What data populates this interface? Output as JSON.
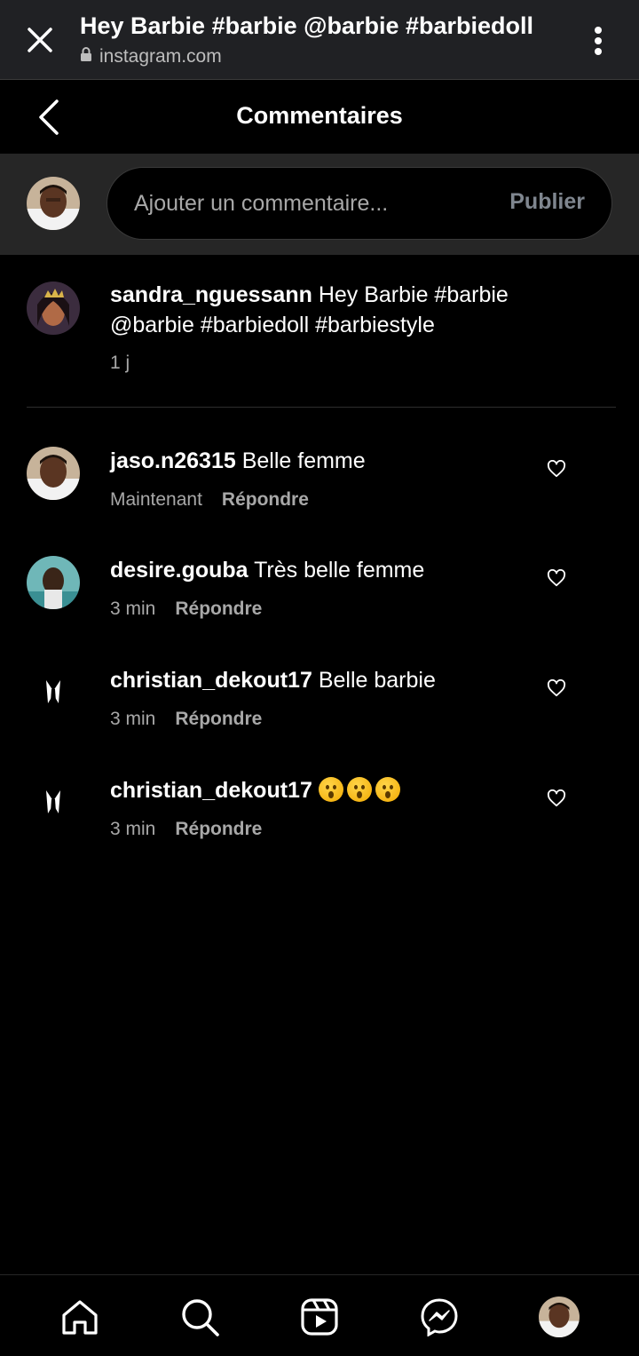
{
  "browser": {
    "title": "Hey Barbie #barbie @barbie #barbiedoll",
    "url": "instagram.com"
  },
  "header": {
    "title": "Commentaires"
  },
  "composer": {
    "placeholder": "Ajouter un commentaire...",
    "publish_label": "Publier"
  },
  "caption": {
    "username": "sandra_nguessann",
    "text": "Hey Barbie #barbie @barbie #barbiedoll #barbiestyle",
    "time": "1 j"
  },
  "comments": [
    {
      "username": "jaso.n26315",
      "text": "Belle femme",
      "time": "Maintenant",
      "reply_label": "Répondre"
    },
    {
      "username": "desire.gouba",
      "text": "Très belle femme",
      "time": "3 min",
      "reply_label": "Répondre"
    },
    {
      "username": "christian_dekout17",
      "text": "Belle barbie",
      "time": "3 min",
      "reply_label": "Répondre"
    },
    {
      "username": "christian_dekout17",
      "text": "",
      "emoji_count": 3,
      "emoji": "hushed-face",
      "time": "3 min",
      "reply_label": "Répondre"
    }
  ],
  "nav": [
    "home-icon",
    "search-icon",
    "reels-icon",
    "messenger-icon",
    "profile-avatar"
  ],
  "colors": {
    "background": "#000000",
    "browser_bar": "#202124",
    "composer_bg": "#262626",
    "muted_text": "#a8a8a8",
    "publish_disabled": "#7f868f"
  }
}
